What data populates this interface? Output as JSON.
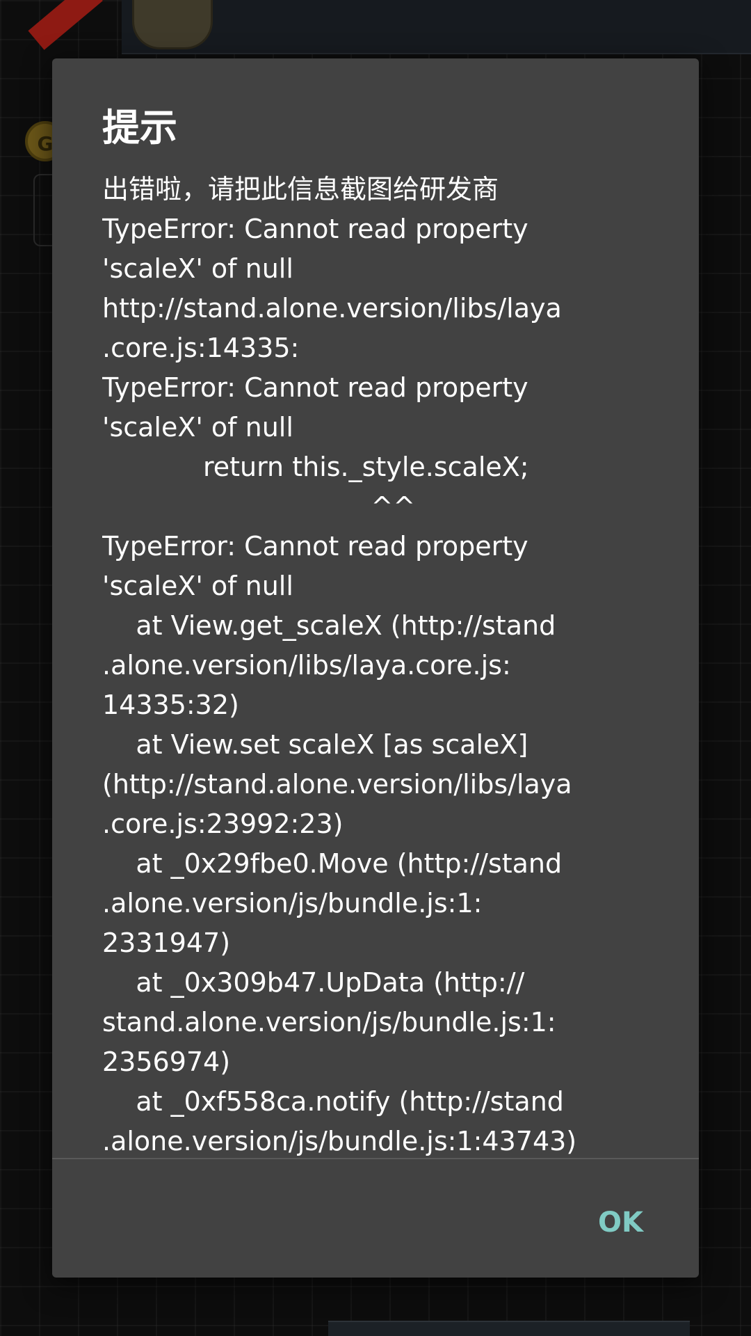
{
  "background": {
    "coin_label": "G"
  },
  "dialog": {
    "title": "提示",
    "message_lines": [
      "出错啦，请把此信息截图给研发商",
      "TypeError: Cannot read property",
      "'scaleX' of null",
      "http://stand.alone.version/libs/laya",
      ".core.js:14335:",
      "TypeError: Cannot read property",
      "'scaleX' of null",
      "            return this._style.scaleX;",
      "                                ^^",
      "TypeError: Cannot read property",
      "'scaleX' of null",
      "    at View.get_scaleX (http://stand",
      ".alone.version/libs/laya.core.js:",
      "14335:32)",
      "    at View.set scaleX [as scaleX]",
      "(http://stand.alone.version/libs/laya",
      ".core.js:23992:23)",
      "    at _0x29fbe0.Move (http://stand",
      ".alone.version/js/bundle.js:1:",
      "2331947)",
      "    at _0x309b47.UpData (http://",
      "stand.alone.version/js/bundle.js:1:",
      "2356974)",
      "    at _0xf558ca.notify (http://stand",
      ".alone.version/js/bundle.js:1:43743)"
    ],
    "ok_label": "OK"
  },
  "colors": {
    "dialog_bg": "#424242",
    "title_text": "#ffffff",
    "message_text": "#ffffff",
    "ok_button": "#80cbc4"
  }
}
